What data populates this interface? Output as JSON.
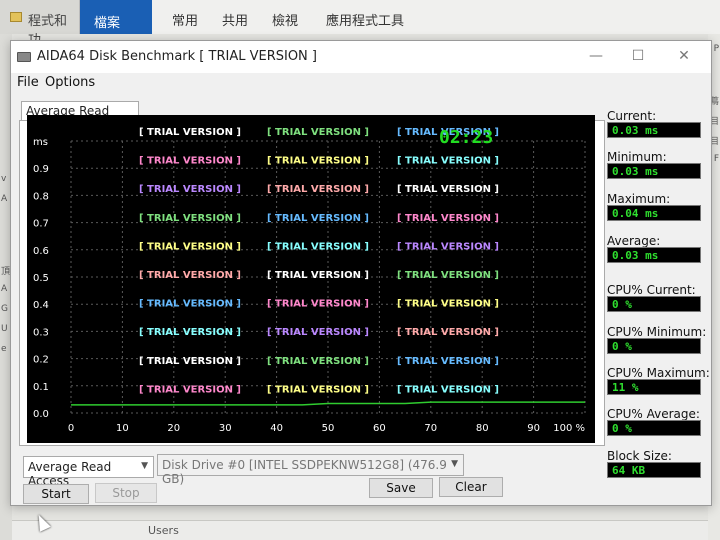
{
  "background": {
    "window_title": "程式和功",
    "ribbon_tabs": [
      "檔案",
      "常用",
      "共用",
      "檢視",
      "應用程式工具"
    ],
    "left_chars": [
      "v",
      "A",
      "頂",
      "A",
      "G",
      "U",
      "e"
    ],
    "right_chars": [
      "P",
      "蔦",
      "目",
      "目",
      "F"
    ],
    "bottom_text": "Users"
  },
  "window": {
    "title": "AIDA64 Disk Benchmark  [ TRIAL VERSION ]",
    "minimize": "—",
    "maximize": "☐",
    "close": "✕"
  },
  "menu": [
    "File",
    "Options"
  ],
  "tab_label": "Average Read Access",
  "graph": {
    "unit": "ms",
    "timer": "02:23",
    "trial_text": "[ TRIAL VERSION ]",
    "watermark_colors": [
      "#ffffff",
      "#7fe07f",
      "#66bbff",
      "#ff88cc",
      "#ffff88",
      "#88ffff",
      "#bb88ff",
      "#ffaaaa"
    ]
  },
  "chart_data": {
    "type": "line",
    "title": "",
    "xlabel": "",
    "ylabel": "ms",
    "xlim": [
      0,
      100
    ],
    "ylim": [
      0.0,
      1.0
    ],
    "x_ticks": [
      "0",
      "10",
      "20",
      "30",
      "40",
      "50",
      "60",
      "70",
      "80",
      "90",
      "100 %"
    ],
    "y_ticks": [
      "0.0",
      "0.1",
      "0.2",
      "0.3",
      "0.4",
      "0.5",
      "0.6",
      "0.7",
      "0.8",
      "0.9",
      "ms"
    ],
    "series": [
      {
        "color": "#2fcc2f",
        "x": [
          0,
          5,
          10,
          15,
          20,
          25,
          30,
          35,
          40,
          45,
          50,
          55,
          60,
          65,
          70,
          75,
          80,
          85,
          90,
          95,
          100
        ],
        "y": [
          0.03,
          0.03,
          0.03,
          0.03,
          0.03,
          0.03,
          0.03,
          0.03,
          0.03,
          0.03,
          0.035,
          0.035,
          0.035,
          0.035,
          0.04,
          0.04,
          0.04,
          0.04,
          0.04,
          0.04,
          0.04
        ]
      }
    ]
  },
  "stats": {
    "current_label": "Current:",
    "current": "0.03 ms",
    "minimum_label": "Minimum:",
    "minimum": "0.03 ms",
    "maximum_label": "Maximum:",
    "maximum": "0.04 ms",
    "average_label": "Average:",
    "average": "0.03 ms",
    "cpu_current_label": "CPU% Current:",
    "cpu_current": "0 %",
    "cpu_minimum_label": "CPU% Minimum:",
    "cpu_minimum": "0 %",
    "cpu_maximum_label": "CPU% Maximum:",
    "cpu_maximum": "11 %",
    "cpu_average_label": "CPU% Average:",
    "cpu_average": "0 %",
    "block_size_label": "Block Size:",
    "block_size": "64 KB"
  },
  "controls": {
    "test_select": "Average Read Access",
    "drive_select": "Disk Drive #0  [INTEL SSDPEKNW512G8]  (476.9 GB)",
    "start": "Start",
    "stop": "Stop",
    "save": "Save",
    "clear": "Clear"
  }
}
